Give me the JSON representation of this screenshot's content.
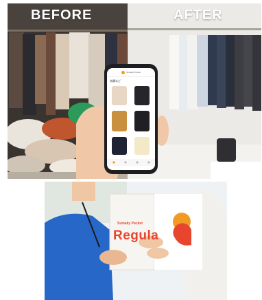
{
  "labels": {
    "before": "BEFORE",
    "after": "AFTER"
  },
  "phone": {
    "header": "Sumally Pocket",
    "section_title": "衣類など"
  },
  "box": {
    "brand": "Sumally Pocket",
    "word": "Regula"
  },
  "colors": {
    "brand_orange": "#f39a25",
    "brand_red": "#e8452f",
    "uniform_blue": "#2667c8"
  }
}
